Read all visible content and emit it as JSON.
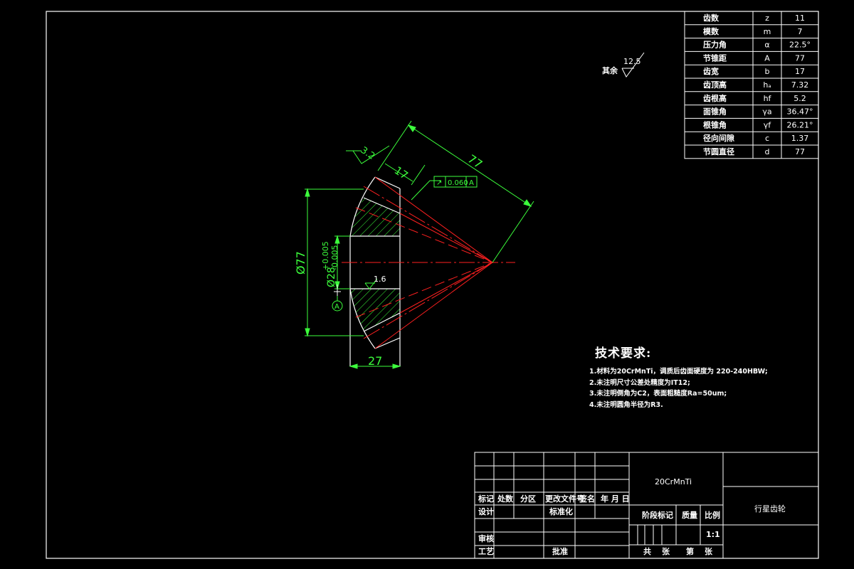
{
  "params_table": {
    "rows": [
      {
        "name": "齿数",
        "symbol": "z",
        "value": "11"
      },
      {
        "name": "模数",
        "symbol": "m",
        "value": "7"
      },
      {
        "name": "压力角",
        "symbol": "α",
        "value": "22.5°"
      },
      {
        "name": "节锥距",
        "symbol": "A",
        "value": "77"
      },
      {
        "name": "齿宽",
        "symbol": "b",
        "value": "17"
      },
      {
        "name": "齿顶高",
        "symbol": "hₐ",
        "value": "7.32"
      },
      {
        "name": "齿根高",
        "symbol": "hf",
        "value": "5.2"
      },
      {
        "name": "面锥角",
        "symbol": "γa",
        "value": "36.47°"
      },
      {
        "name": "根锥角",
        "symbol": "γf",
        "value": "26.21°"
      },
      {
        "name": "径向间隙",
        "symbol": "c",
        "value": "1.37"
      },
      {
        "name": "节圆直径",
        "symbol": "d",
        "value": "77"
      }
    ]
  },
  "roughness_note": {
    "label": "其余",
    "value": "12.5"
  },
  "drawing": {
    "dim_cone_distance": "77",
    "dim_face_width": "17",
    "dim_outer_diameter": "Ø77",
    "dim_bore": "Ø28",
    "bore_tol_upper": "+0.005",
    "bore_tol_lower": "-0.005",
    "dim_hub_length": "27",
    "roughness_face": "3.2",
    "roughness_bore": "1.6",
    "gdt_value": "0.060",
    "gdt_datum": "A",
    "datum_label": "A"
  },
  "tech_requirements": {
    "title": "技术要求:",
    "items": [
      "1.材料为20CrMnTi，调质后齿面硬度为 220-240HBW;",
      "2.未注明尺寸公差处精度为IT12;",
      "3.未注明倒角为C2，表面粗糙度Ra=50um;",
      "4.未注明圆角半径为R3."
    ]
  },
  "title_block": {
    "material": "20CrMnTi",
    "part_name": "行星齿轮",
    "scale": "1:1",
    "headers": {
      "mark": "标记",
      "count": "处数",
      "zone": "分区",
      "doc_no": "更改文件号",
      "sign": "签名",
      "date": "年 月 日",
      "design": "设计",
      "standard": "标准化",
      "stage": "阶段标记",
      "weight": "质量",
      "ratio": "比例",
      "review": "审核",
      "process": "工艺",
      "approve": "批准",
      "total": "共",
      "sheets": "张",
      "sheet_no": "第",
      "sheet_unit": "张"
    }
  },
  "colors": {
    "background": "#000000",
    "lines": "#ffffff",
    "dimensions": "#3cff3c",
    "centerlines": "#ff2020"
  }
}
